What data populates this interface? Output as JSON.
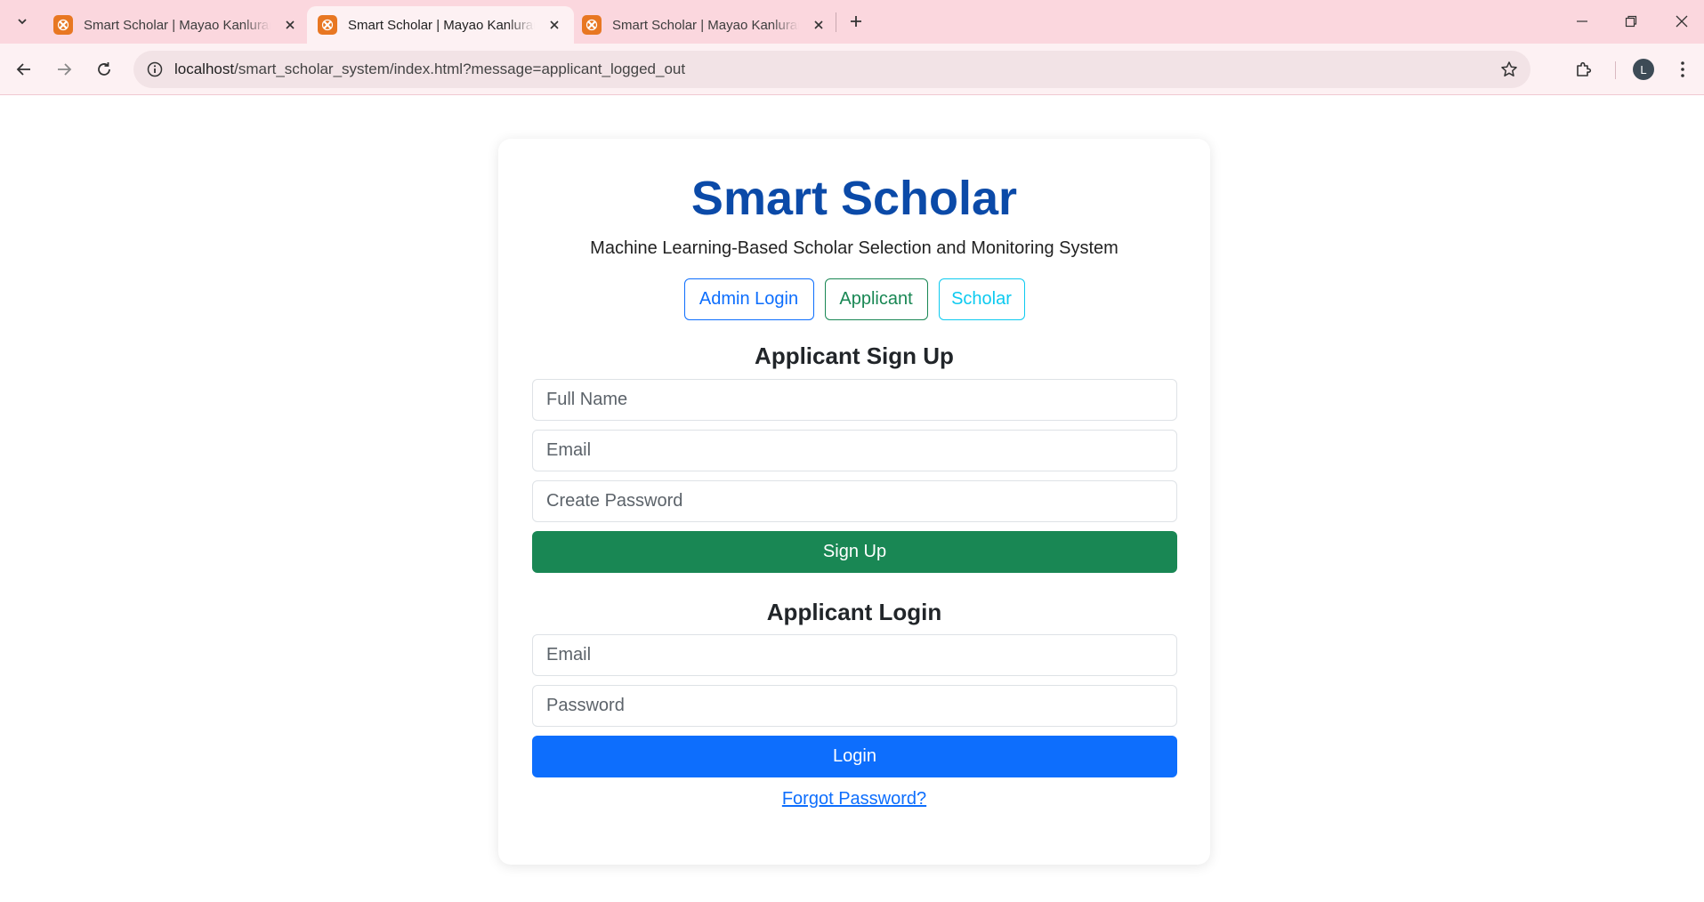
{
  "browser": {
    "tabs": [
      {
        "title": "Smart Scholar | Mayao Kanluran"
      },
      {
        "title": "Smart Scholar | Mayao Kanluran"
      },
      {
        "title": "Smart Scholar | Mayao Kanluran"
      }
    ],
    "url_host": "localhost",
    "url_path": "/smart_scholar_system/index.html?message=applicant_logged_out",
    "profile_initial": "L"
  },
  "page": {
    "title": "Smart Scholar",
    "subtitle": "Machine Learning-Based Scholar Selection and Monitoring System",
    "role_buttons": {
      "admin": "Admin Login",
      "applicant": "Applicant",
      "scholar": "Scholar"
    },
    "signup": {
      "heading": "Applicant Sign Up",
      "fullname_placeholder": "Full Name",
      "email_placeholder": "Email",
      "password_placeholder": "Create Password",
      "button": "Sign Up"
    },
    "login": {
      "heading": "Applicant Login",
      "email_placeholder": "Email",
      "password_placeholder": "Password",
      "button": "Login"
    },
    "forgot_link": "Forgot Password?"
  }
}
